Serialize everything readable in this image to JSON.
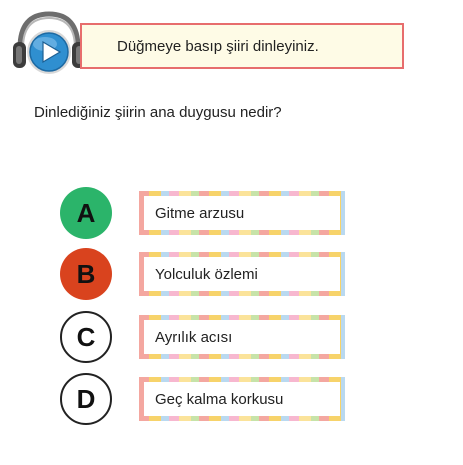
{
  "audio": {
    "icon": "headphones-play-icon",
    "accent_color": "#2f8fd0"
  },
  "instruction": {
    "text": "Düğmeye basıp şiiri dinleyiniz."
  },
  "question": {
    "text": "Dinlediğiniz şiirin ana duygusu nedir?"
  },
  "options": [
    {
      "letter": "A",
      "label": "Gitme arzusu",
      "color": "#2bb46a",
      "style": "filled"
    },
    {
      "letter": "B",
      "label": "Yolculuk özlemi",
      "color": "#d9431e",
      "style": "filled"
    },
    {
      "letter": "C",
      "label": "Ayrılık acısı",
      "color": "#ffffff",
      "style": "outline"
    },
    {
      "letter": "D",
      "label": "Geç kalma korkusu",
      "color": "#ffffff",
      "style": "outline"
    }
  ]
}
